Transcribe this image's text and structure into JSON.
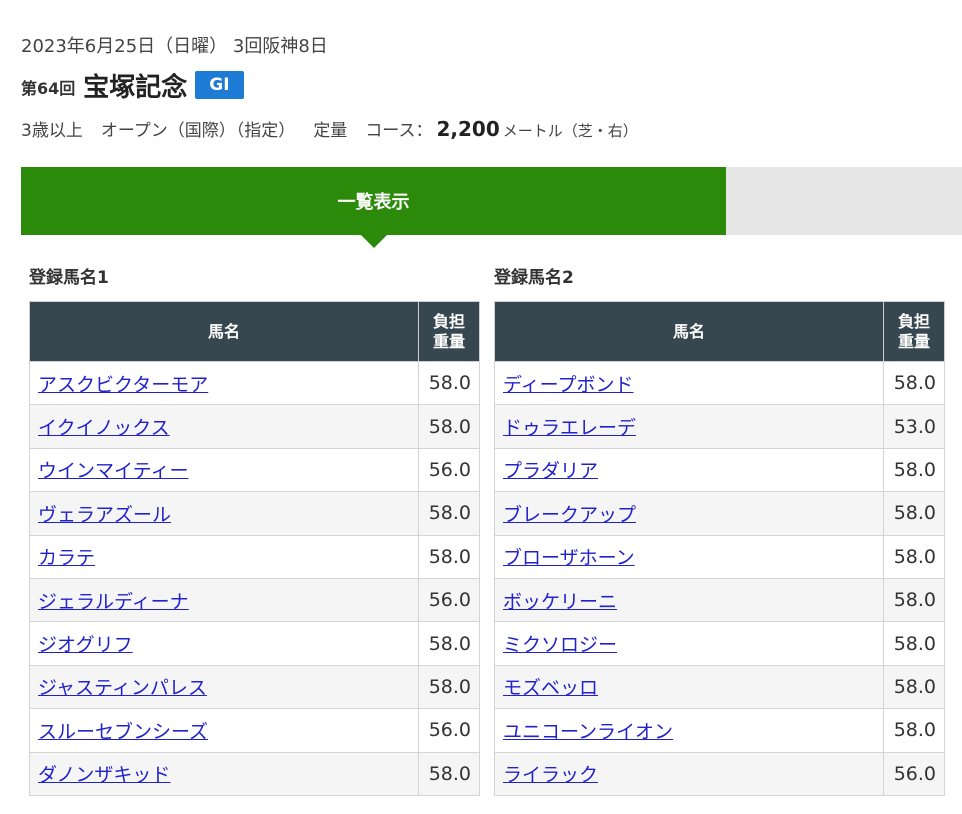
{
  "race": {
    "date": "2023年6月25日（日曜） 3回阪神8日",
    "number": "第64回",
    "name": "宝塚記念",
    "grade": "GI",
    "age_condition": "3歳以上",
    "class": "オープン（国際）（指定）",
    "weight_rule": "定量",
    "course_label": "コース：",
    "course_distance": "2,200",
    "course_unit": "メートル（芝・右）"
  },
  "tabs": {
    "active_label": "一覧表示"
  },
  "colors": {
    "tab_active": "#2b8a0a",
    "table_header": "#37474f",
    "grade_badge": "#1e7bd6",
    "link": "#2222cc"
  },
  "tables": {
    "header_name": "馬名",
    "header_weight_1": "負担",
    "header_weight_2": "重量",
    "left": {
      "title": "登録馬名1",
      "rows": [
        {
          "name": "アスクビクターモア",
          "weight": "58.0"
        },
        {
          "name": "イクイノックス",
          "weight": "58.0"
        },
        {
          "name": "ウインマイティー",
          "weight": "56.0"
        },
        {
          "name": "ヴェラアズール",
          "weight": "58.0"
        },
        {
          "name": "カラテ",
          "weight": "58.0"
        },
        {
          "name": "ジェラルディーナ",
          "weight": "56.0"
        },
        {
          "name": "ジオグリフ",
          "weight": "58.0"
        },
        {
          "name": "ジャスティンパレス",
          "weight": "58.0"
        },
        {
          "name": "スルーセブンシーズ",
          "weight": "56.0"
        },
        {
          "name": "ダノンザキッド",
          "weight": "58.0"
        }
      ]
    },
    "right": {
      "title": "登録馬名2",
      "rows": [
        {
          "name": "ディープボンド",
          "weight": "58.0"
        },
        {
          "name": "ドゥラエレーデ",
          "weight": "53.0"
        },
        {
          "name": "プラダリア",
          "weight": "58.0"
        },
        {
          "name": "ブレークアップ",
          "weight": "58.0"
        },
        {
          "name": "ブローザホーン",
          "weight": "58.0"
        },
        {
          "name": "ボッケリーニ",
          "weight": "58.0"
        },
        {
          "name": "ミクソロジー",
          "weight": "58.0"
        },
        {
          "name": "モズベッロ",
          "weight": "58.0"
        },
        {
          "name": "ユニコーンライオン",
          "weight": "58.0"
        },
        {
          "name": "ライラック",
          "weight": "56.0"
        }
      ]
    }
  }
}
